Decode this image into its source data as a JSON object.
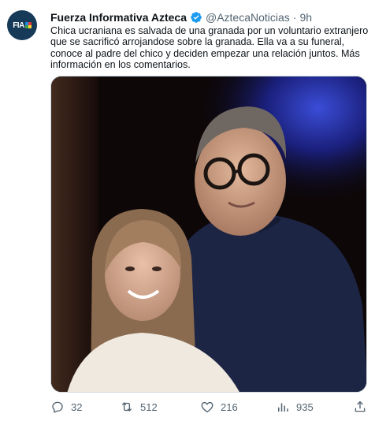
{
  "account": {
    "name": "Fuerza Informativa Azteca",
    "handle": "@AztecaNoticias",
    "separator": "·",
    "time": "9h",
    "avatar_text": "FIA"
  },
  "tweet": {
    "text": "Chica ucraniana es salvada de una granada por un voluntario extranjero que se sacrificó arrojandose sobre la granada. Ella va a su funeral, conoce al padre del chico y deciden empezar una relación juntos. Más información en los comentarios."
  },
  "actions": {
    "replies": "32",
    "retweets": "512",
    "likes": "216",
    "views": "935"
  },
  "colors": {
    "verified": "#1d9bf0",
    "secondary_text": "#536471",
    "avatar_bg": "#163a58"
  },
  "icons": [
    "verified-badge-icon",
    "reply-icon",
    "retweet-icon",
    "like-icon",
    "views-icon",
    "share-icon"
  ]
}
